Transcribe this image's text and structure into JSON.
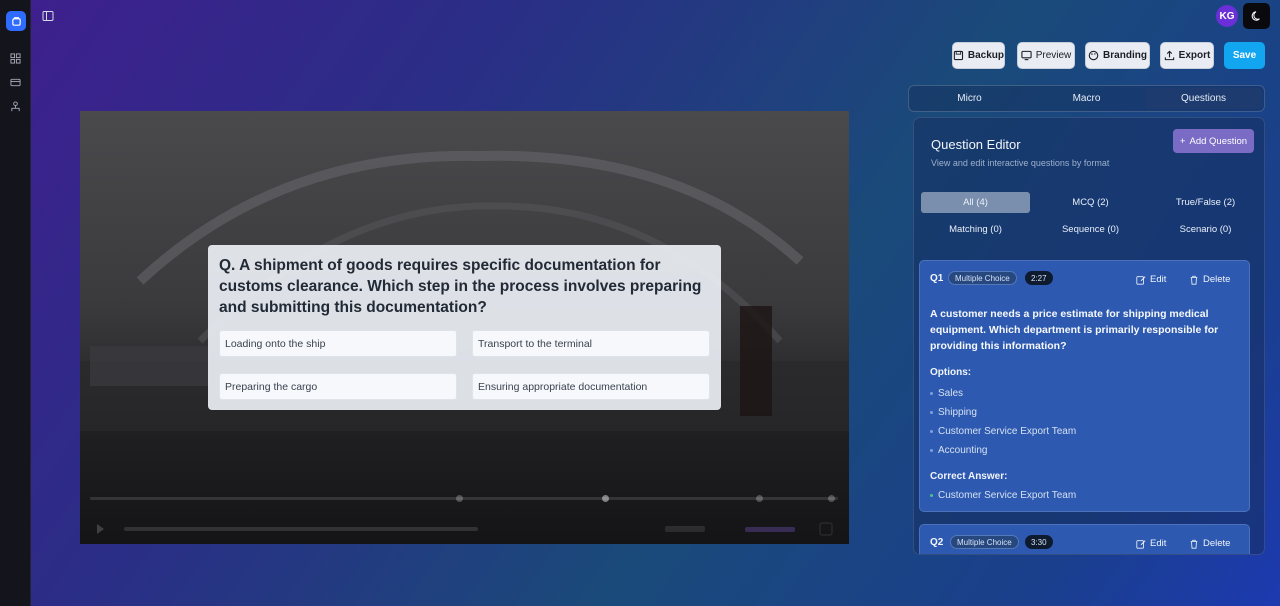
{
  "header": {
    "avatar_initials": "KG"
  },
  "toolbar": {
    "backup_label": "Backup",
    "preview_label": "Preview",
    "branding_label": "Branding",
    "export_label": "Export",
    "save_label": "Save"
  },
  "tabs": [
    {
      "label": "Micro",
      "active": false
    },
    {
      "label": "Macro",
      "active": false
    },
    {
      "label": "Questions",
      "active": true
    }
  ],
  "player": {
    "question": "Q. A shipment of goods requires specific documentation for customs clearance. Which step in the process involves preparing and submitting this documentation?",
    "options": [
      "Loading onto the ship",
      "Transport to the terminal",
      "Preparing the cargo",
      "Ensuring appropriate documentation"
    ]
  },
  "editor": {
    "title": "Question Editor",
    "subtitle": "View and edit interactive questions by format",
    "add_label": "Add Question",
    "filters": [
      {
        "label": "All (4)",
        "active": true
      },
      {
        "label": "MCQ (2)",
        "active": false
      },
      {
        "label": "True/False (2)",
        "active": false
      },
      {
        "label": "Matching (0)",
        "active": false
      },
      {
        "label": "Sequence (0)",
        "active": false
      },
      {
        "label": "Scenario (0)",
        "active": false
      }
    ],
    "questions": [
      {
        "num": "Q1",
        "type": "Multiple Choice",
        "time": "2:27",
        "edit_label": "Edit",
        "delete_label": "Delete",
        "text": "A customer needs a price estimate for shipping medical equipment. Which department is primarily responsible for providing this information?",
        "options_label": "Options:",
        "options": [
          "Sales",
          "Shipping",
          "Customer Service Export Team",
          "Accounting"
        ],
        "answer_label": "Correct Answer:",
        "answer": "Customer Service Export Team"
      },
      {
        "num": "Q2",
        "type": "Multiple Choice",
        "time": "3:30",
        "edit_label": "Edit",
        "delete_label": "Delete"
      }
    ]
  },
  "colors": {
    "accent": "#12a5f0",
    "purple": "#7a6bc4",
    "card": "#2d5ab0"
  }
}
